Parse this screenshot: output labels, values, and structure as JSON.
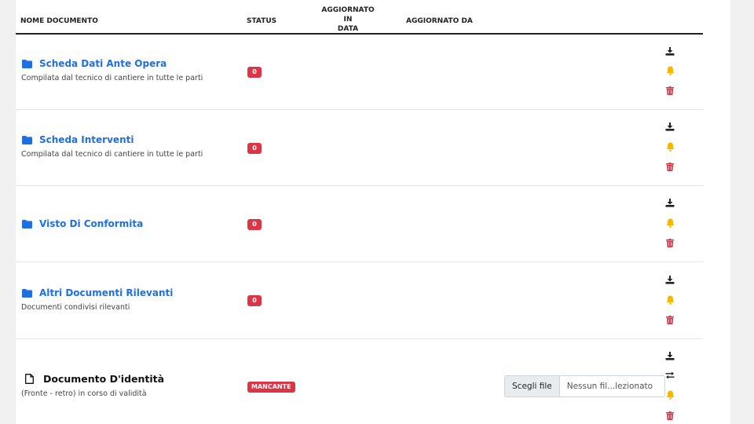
{
  "table": {
    "headers": {
      "name": "NOME DOCUMENTO",
      "status": "STATUS",
      "updated_on_line1": "AGGIORNATO IN",
      "updated_on_line2": "DATA",
      "updated_by": "AGGIORNATO DA"
    },
    "rows": [
      {
        "title": "Scheda Dati Ante Opera",
        "subtitle": "Compilata dal tecnico di cantiere in tutte le parti",
        "status": "0",
        "icon": "folder-icon"
      },
      {
        "title": "Scheda Interventi",
        "subtitle": "Compilata dal tecnico di cantiere in tutte le parti",
        "status": "0",
        "icon": "folder-icon"
      },
      {
        "title": "Visto Di Conformita",
        "subtitle": "",
        "status": "0",
        "icon": "folder-icon"
      },
      {
        "title": "Altri Documenti Rilevanti",
        "subtitle": "Documenti condivisi rilevanti",
        "status": "0",
        "icon": "folder-icon"
      },
      {
        "title": "Documento D'identità",
        "subtitle": "(Fronte - retro) in corso di validità",
        "status": "MANCANTE",
        "icon": "file-icon",
        "file_input": {
          "button": "Scegli file",
          "placeholder": "Nessun fil...lezionato"
        }
      }
    ]
  },
  "colors": {
    "link": "#1f6fe0",
    "danger": "#dc3545",
    "warning": "#f5b800",
    "dark": "#222222"
  }
}
